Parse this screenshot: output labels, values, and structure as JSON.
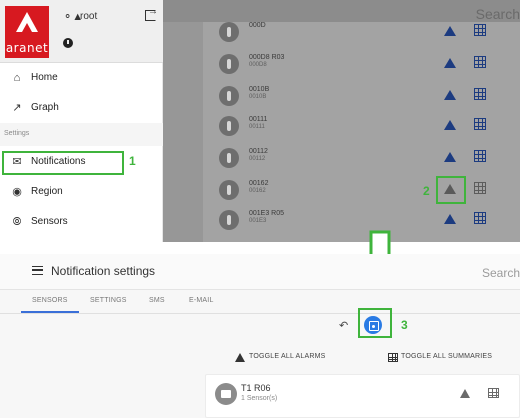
{
  "top": {
    "user": "root",
    "search_placeholder": "Search",
    "logo_text": "aranet",
    "nav_items": [
      {
        "label": "Home",
        "icon": "home-icon"
      },
      {
        "label": "Graph",
        "icon": "graph-icon"
      },
      {
        "label": "Notifications",
        "icon": "notifications-icon"
      },
      {
        "label": "Region",
        "icon": "region-icon"
      },
      {
        "label": "Sensors",
        "icon": "sensors-icon"
      }
    ],
    "section_label": "Settings",
    "sensor_rows": [
      {
        "name": "000D",
        "sub": ""
      },
      {
        "name": "000D8 R03",
        "sub": "000D8"
      },
      {
        "name": "0010B",
        "sub": "0010B"
      },
      {
        "name": "00111",
        "sub": "00111"
      },
      {
        "name": "00112",
        "sub": "00112"
      },
      {
        "name": "00162",
        "sub": "00162"
      },
      {
        "name": "001E3 R05",
        "sub": "001E3"
      }
    ],
    "markers": {
      "one": "1",
      "two": "2"
    }
  },
  "bottom": {
    "title": "Notification settings",
    "search_placeholder": "Search",
    "tabs": [
      "SENSORS",
      "SETTINGS",
      "SMS",
      "E-MAIL"
    ],
    "active_tab": "SENSORS",
    "toggle_alarms": "TOGGLE ALL ALARMS",
    "toggle_summaries": "TOGGLE ALL SUMMARIES",
    "group": {
      "name": "T1 R06",
      "sub": "1 Sensor(s)"
    },
    "marker_three": "3"
  },
  "colors": {
    "accent": "#2a7be4",
    "icon_blue": "#1c3b80",
    "annotation": "#3fb43c",
    "brand": "#d71920"
  }
}
